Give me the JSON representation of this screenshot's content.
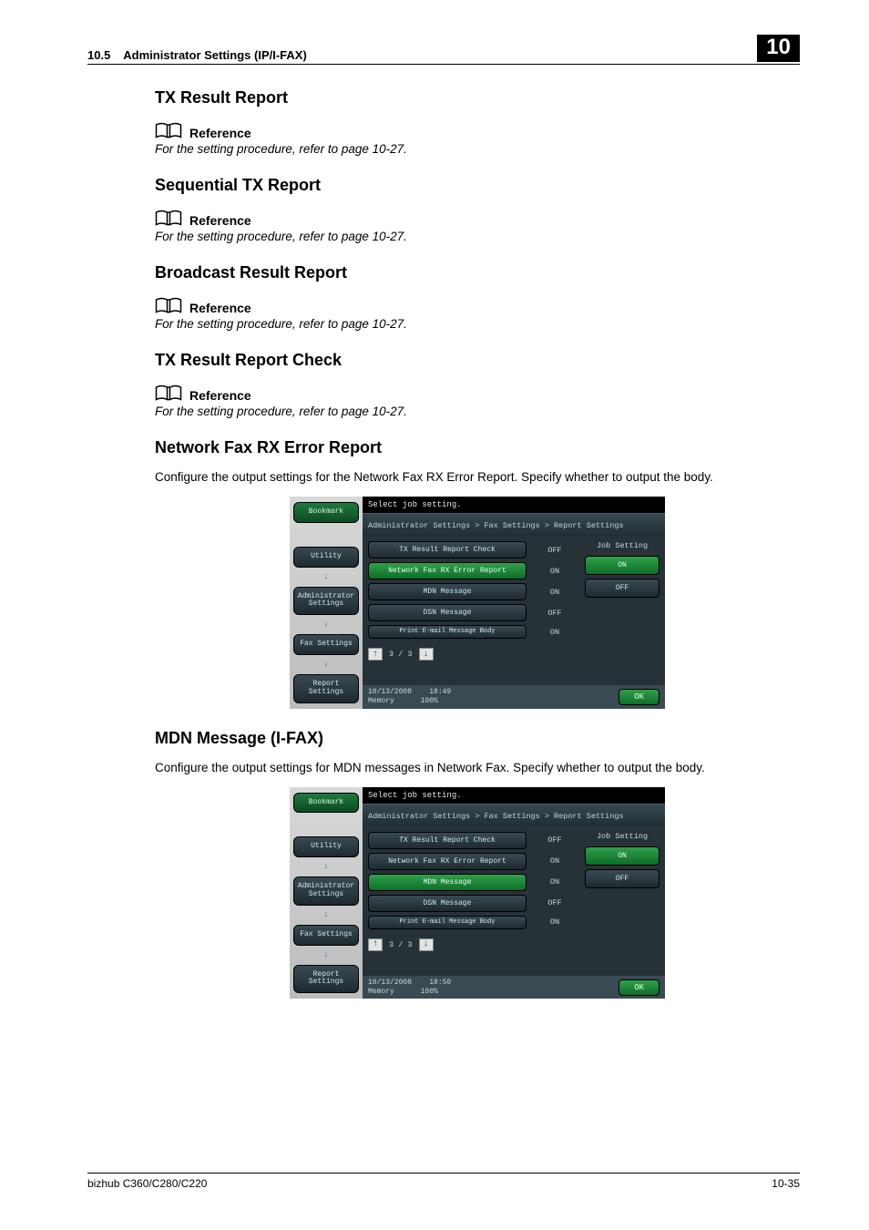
{
  "header": {
    "section_no": "10.5",
    "section_title": "Administrator Settings (IP/I-FAX)",
    "chapter_no": "10"
  },
  "sections": {
    "s1": {
      "title": "TX Result Report",
      "ref_label": "Reference",
      "ref_text": "For the setting procedure, refer to page 10-27."
    },
    "s2": {
      "title": "Sequential TX Report",
      "ref_label": "Reference",
      "ref_text": "For the setting procedure, refer to page 10-27."
    },
    "s3": {
      "title": "Broadcast Result Report",
      "ref_label": "Reference",
      "ref_text": "For the setting procedure, refer to page 10-27."
    },
    "s4": {
      "title": "TX Result Report Check",
      "ref_label": "Reference",
      "ref_text": "For the setting procedure, refer to page 10-27."
    },
    "s5": {
      "title": "Network Fax RX Error Report",
      "body": "Configure the output settings for the Network Fax RX Error Report. Specify whether to output the body."
    },
    "s6": {
      "title": "MDN Message (I-FAX)",
      "body": "Configure the output settings for MDN messages in Network Fax. Specify whether to output the body."
    }
  },
  "screen1": {
    "instruction": "Select job setting.",
    "breadcrumb": "Administrator Settings > Fax Settings > Report Settings",
    "sidebar": {
      "bookmark": "Bookmark",
      "utility": "Utility",
      "admin": "Administrator Settings",
      "fax": "Fax Settings",
      "report": "Report Settings"
    },
    "items": [
      {
        "label": "TX Result Report Check",
        "value": "OFF"
      },
      {
        "label": "Network Fax RX Error Report",
        "value": "ON",
        "highlight": true
      },
      {
        "label": "MDN Message",
        "value": "ON"
      },
      {
        "label": "DSN Message",
        "value": "OFF"
      },
      {
        "label": "Print E-mail Message Body",
        "value": "ON",
        "small": true
      }
    ],
    "job_label": "Job Setting",
    "opt_on": "ON",
    "opt_off": "OFF",
    "page": "3 / 3",
    "footer": {
      "date": "10/13/2008",
      "time": "18:49",
      "mem_label": "Memory",
      "mem_val": "100%"
    },
    "ok": "OK"
  },
  "screen2": {
    "instruction": "Select job setting.",
    "breadcrumb": "Administrator Settings > Fax Settings > Report Settings",
    "sidebar": {
      "bookmark": "Bookmark",
      "utility": "Utility",
      "admin": "Administrator Settings",
      "fax": "Fax Settings",
      "report": "Report Settings"
    },
    "items": [
      {
        "label": "TX Result Report Check",
        "value": "OFF"
      },
      {
        "label": "Network Fax RX Error Report",
        "value": "ON"
      },
      {
        "label": "MDN Message",
        "value": "ON",
        "highlight": true
      },
      {
        "label": "DSN Message",
        "value": "OFF"
      },
      {
        "label": "Print E-mail Message Body",
        "value": "ON",
        "small": true
      }
    ],
    "job_label": "Job Setting",
    "opt_on": "ON",
    "opt_off": "OFF",
    "page": "3 / 3",
    "footer": {
      "date": "10/13/2008",
      "time": "18:50",
      "mem_label": "Memory",
      "mem_val": "100%"
    },
    "ok": "OK"
  },
  "footer": {
    "model": "bizhub C360/C280/C220",
    "page": "10-35"
  }
}
